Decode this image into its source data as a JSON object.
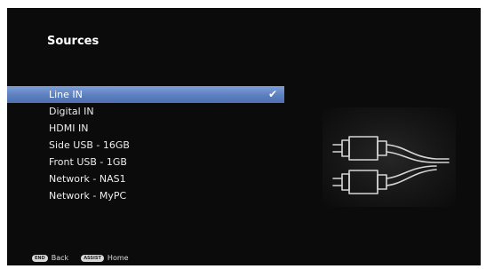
{
  "screen": {
    "title": "Sources"
  },
  "sources": [
    {
      "label": "Line IN",
      "selected": true
    },
    {
      "label": "Digital IN",
      "selected": false
    },
    {
      "label": "HDMI IN",
      "selected": false
    },
    {
      "label": "Side USB - 16GB",
      "selected": false
    },
    {
      "label": "Front USB - 1GB",
      "selected": false
    },
    {
      "label": "Network - NAS1",
      "selected": false
    },
    {
      "label": "Network - MyPC",
      "selected": false
    }
  ],
  "selected_mark_icon": "checkmark-icon",
  "illustration_icon": "cable-plugs-icon",
  "footer": {
    "back_key": "END",
    "back_label": "Back",
    "home_key": "ASSIST",
    "home_label": "Home"
  },
  "colors": {
    "background": "#0b0b0b",
    "selection": "#5c7fbf",
    "text": "#ececec"
  }
}
